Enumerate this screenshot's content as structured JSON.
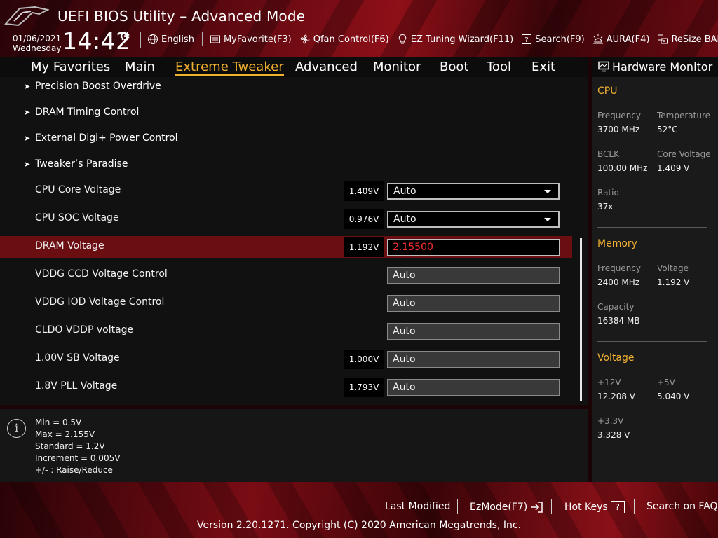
{
  "header": {
    "title": "UEFI BIOS Utility – Advanced Mode",
    "date": "01/06/2021",
    "weekday": "Wednesday",
    "time": "14:42",
    "toolbar": [
      {
        "label": "English",
        "icon": "globe-icon"
      },
      {
        "label": "MyFavorite(F3)",
        "icon": "favorite-list-icon"
      },
      {
        "label": "Qfan Control(F6)",
        "icon": "fan-icon"
      },
      {
        "label": "EZ Tuning Wizard(F11)",
        "icon": "lightbulb-icon"
      },
      {
        "label": "Search(F9)",
        "icon": "help-box-icon"
      },
      {
        "label": "AURA(F4)",
        "icon": "aura-light-icon"
      },
      {
        "label": "ReSize BAR",
        "icon": "resize-bar-icon"
      }
    ]
  },
  "nav": {
    "tabs": [
      "My Favorites",
      "Main",
      "Extreme Tweaker",
      "Advanced",
      "Monitor",
      "Boot",
      "Tool",
      "Exit"
    ],
    "active": "Extreme Tweaker"
  },
  "main": {
    "submenus": [
      "Precision Boost Overdrive",
      "DRAM Timing Control",
      "External Digi+ Power Control",
      "Tweaker’s Paradise"
    ],
    "settings": [
      {
        "label": "CPU Core Voltage",
        "current": "1.409V",
        "value": "Auto"
      },
      {
        "label": "CPU SOC Voltage",
        "current": "0.976V",
        "value": "Auto"
      },
      {
        "label": "DRAM Voltage",
        "current": "1.192V",
        "value": "2.15500"
      },
      {
        "label": "VDDG CCD Voltage Control",
        "current": "",
        "value": "Auto"
      },
      {
        "label": "VDDG IOD Voltage Control",
        "current": "",
        "value": "Auto"
      },
      {
        "label": "CLDO VDDP voltage",
        "current": "",
        "value": "Auto"
      },
      {
        "label": "1.00V SB Voltage",
        "current": "1.000V",
        "value": "Auto"
      },
      {
        "label": "1.8V PLL Voltage",
        "current": "1.793V",
        "value": "Auto"
      }
    ]
  },
  "info": {
    "lines": [
      "Min = 0.5V",
      "Max = 2.155V",
      "Standard = 1.2V",
      "Increment = 0.005V",
      "+/- : Raise/Reduce"
    ]
  },
  "hw_monitor": {
    "title": "Hardware Monitor",
    "cpu": {
      "heading": "CPU",
      "frequency_label": "Frequency",
      "frequency": "3700 MHz",
      "temperature_label": "Temperature",
      "temperature": "52°C",
      "bclk_label": "BCLK",
      "bclk": "100.00 MHz",
      "core_voltage_label": "Core Voltage",
      "core_voltage": "1.409 V",
      "ratio_label": "Ratio",
      "ratio": "37x"
    },
    "memory": {
      "heading": "Memory",
      "frequency_label": "Frequency",
      "frequency": "2400 MHz",
      "voltage_label": "Voltage",
      "voltage": "1.192 V",
      "capacity_label": "Capacity",
      "capacity": "16384 MB"
    },
    "voltage": {
      "heading": "Voltage",
      "v12_label": "+12V",
      "v12": "12.208 V",
      "v5_label": "+5V",
      "v5": "5.040 V",
      "v33_label": "+3.3V",
      "v33": "3.328 V"
    }
  },
  "footer": {
    "last_modified": "Last Modified",
    "ezmode": "EzMode(F7)",
    "hotkeys": "Hot Keys",
    "hotkeys_icon_text": "?",
    "faq": "Search on FAQ",
    "version": "Version 2.20.1271. Copyright (C) 2020 American Megatrends, Inc."
  },
  "colors": {
    "accent": "#f0b030",
    "selected_row": "#6a0e12",
    "edit_value": "#ff3030"
  }
}
